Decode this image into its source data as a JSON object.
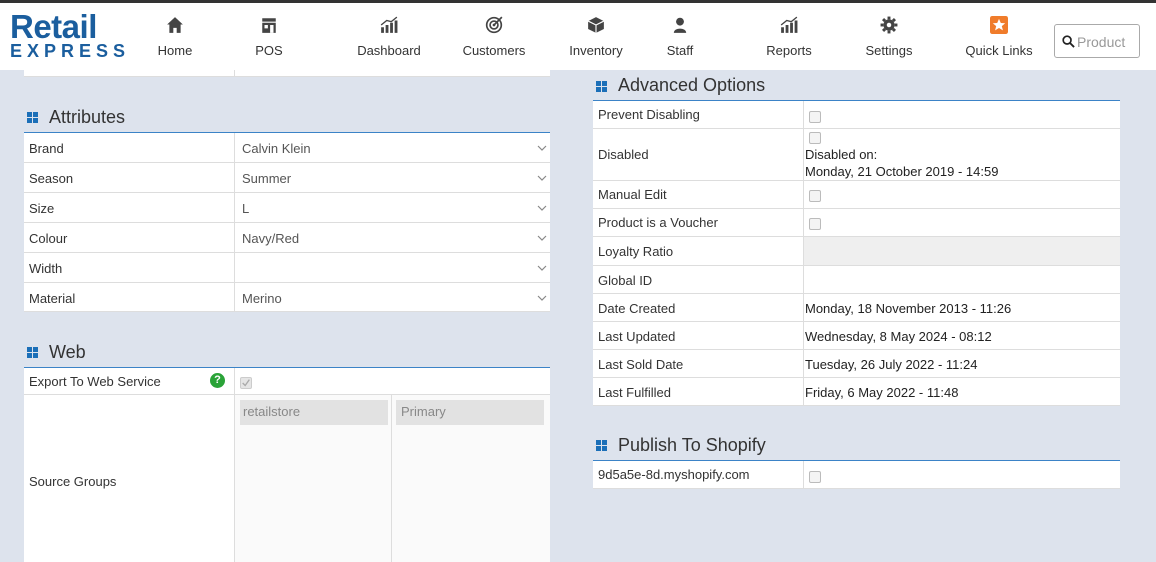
{
  "brand": {
    "line1": "Retail",
    "line2": "EXPRESS"
  },
  "nav": [
    {
      "label": "Home",
      "icon": "home-icon"
    },
    {
      "label": "POS",
      "icon": "store-icon"
    },
    {
      "label": "Dashboard",
      "icon": "bar-chart-icon"
    },
    {
      "label": "Customers",
      "icon": "target-icon"
    },
    {
      "label": "Inventory",
      "icon": "box-icon"
    },
    {
      "label": "Staff",
      "icon": "person-icon"
    },
    {
      "label": "Reports",
      "icon": "bar-chart-icon"
    },
    {
      "label": "Settings",
      "icon": "gear-icon"
    },
    {
      "label": "Quick Links",
      "icon": "star-icon"
    }
  ],
  "search": {
    "placeholder": "Product"
  },
  "attributes": {
    "title": "Attributes",
    "rows": [
      {
        "label": "Brand",
        "value": "Calvin Klein"
      },
      {
        "label": "Season",
        "value": "Summer"
      },
      {
        "label": "Size",
        "value": "L"
      },
      {
        "label": "Colour",
        "value": "Navy/Red"
      },
      {
        "label": "Width",
        "value": ""
      },
      {
        "label": "Material",
        "value": "Merino"
      }
    ]
  },
  "web": {
    "title": "Web",
    "export_label": "Export To Web Service",
    "help": "?",
    "source_groups_label": "Source Groups",
    "source_groups": [
      "retailstore",
      "Primary"
    ]
  },
  "advanced": {
    "title": "Advanced Options",
    "prevent_disabling": "Prevent Disabling",
    "disabled": "Disabled",
    "disabled_on_label": "Disabled on:",
    "disabled_on_value": "Monday, 21 October 2019 - 14:59",
    "manual_edit": "Manual Edit",
    "voucher": "Product is a Voucher",
    "loyalty_ratio": "Loyalty Ratio",
    "global_id": "Global ID",
    "dates": [
      {
        "label": "Date Created",
        "value": "Monday, 18 November 2013 - 11:26"
      },
      {
        "label": "Last Updated",
        "value": "Wednesday, 8 May 2024 - 08:12"
      },
      {
        "label": "Last Sold Date",
        "value": "Tuesday, 26 July 2022 - 11:24"
      },
      {
        "label": "Last Fulfilled",
        "value": "Friday, 6 May 2022 - 11:48"
      }
    ]
  },
  "shopify": {
    "title": "Publish To Shopify",
    "store": "9d5a5e-8d.myshopify.com"
  },
  "colors": {
    "accent": "#1b6fb8",
    "brand": "#1b5e9e",
    "help": "#2aa338",
    "background": "#dde3ed"
  }
}
